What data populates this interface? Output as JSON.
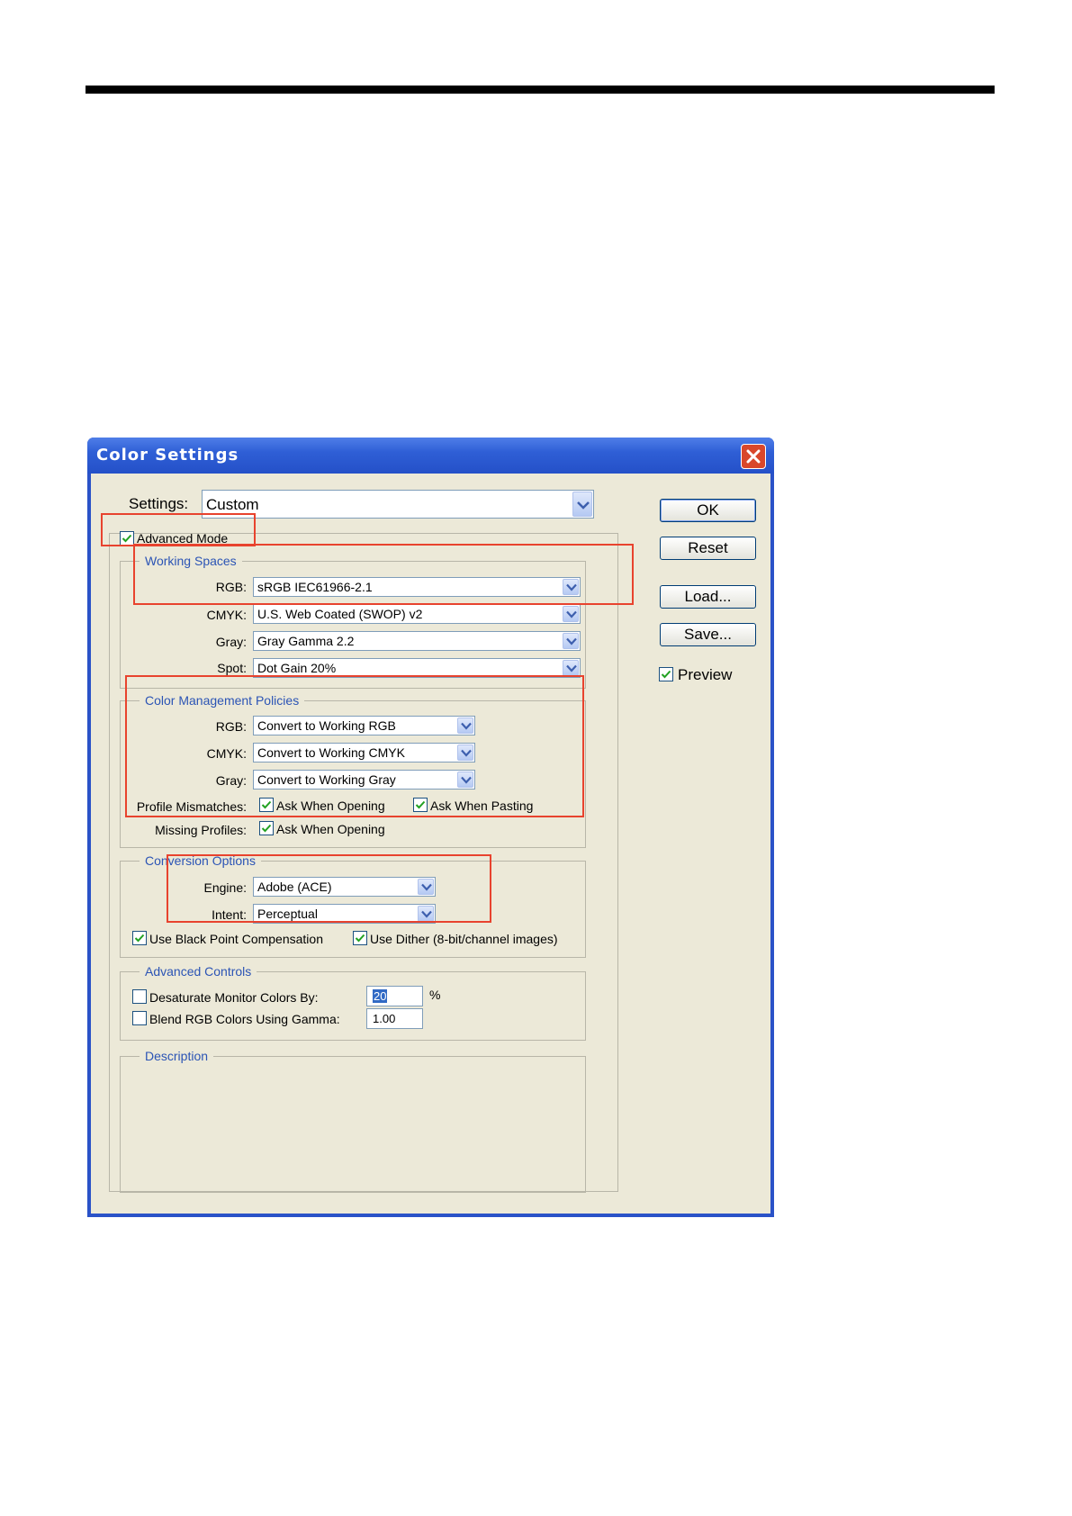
{
  "title": "Color Settings",
  "settings": {
    "label": "Settings:",
    "value": "Custom"
  },
  "advanced_mode": {
    "label": "Advanced Mode",
    "checked": true
  },
  "working_spaces": {
    "legend": "Working Spaces",
    "rgb": {
      "label": "RGB:",
      "value": "sRGB IEC61966-2.1"
    },
    "cmyk": {
      "label": "CMYK:",
      "value": "U.S. Web Coated (SWOP) v2"
    },
    "gray": {
      "label": "Gray:",
      "value": "Gray Gamma 2.2"
    },
    "spot": {
      "label": "Spot:",
      "value": "Dot Gain 20%"
    }
  },
  "policies": {
    "legend": "Color Management Policies",
    "rgb": {
      "label": "RGB:",
      "value": "Convert to Working RGB"
    },
    "cmyk": {
      "label": "CMYK:",
      "value": "Convert to Working CMYK"
    },
    "gray": {
      "label": "Gray:",
      "value": "Convert to Working Gray"
    },
    "profile_mismatches": {
      "label": "Profile Mismatches:",
      "ask_opening": "Ask When Opening",
      "ask_pasting": "Ask When Pasting"
    },
    "missing_profiles": {
      "label": "Missing Profiles:",
      "ask_opening": "Ask When Opening"
    }
  },
  "conversion": {
    "legend": "Conversion Options",
    "engine": {
      "label": "Engine:",
      "value": "Adobe (ACE)"
    },
    "intent": {
      "label": "Intent:",
      "value": "Perceptual"
    },
    "black_point": "Use Black Point Compensation",
    "dither": "Use Dither (8-bit/channel images)"
  },
  "advanced_controls": {
    "legend": "Advanced Controls",
    "desaturate": {
      "label": "Desaturate Monitor Colors By:",
      "value": "20",
      "unit": "%"
    },
    "blend": {
      "label": "Blend RGB Colors Using Gamma:",
      "value": "1.00"
    }
  },
  "description": {
    "legend": "Description"
  },
  "buttons": {
    "ok": "OK",
    "reset": "Reset",
    "load": "Load...",
    "save": "Save..."
  },
  "preview": {
    "label": "Preview",
    "checked": true
  },
  "colors": {
    "titlebar": "#2f5fd6",
    "dialog_bg": "#ece9d8",
    "highlight_box": "#e8432e",
    "legend_text": "#2b54b5"
  }
}
